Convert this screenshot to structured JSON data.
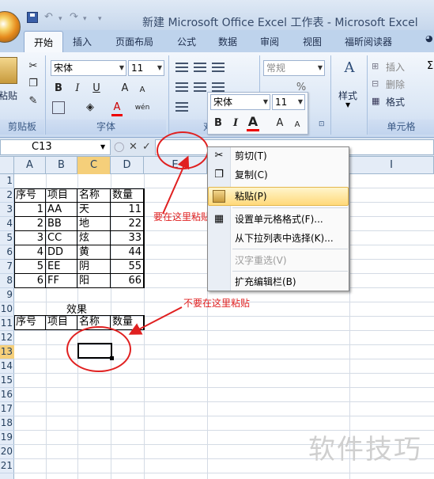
{
  "window": {
    "title": "新建 Microsoft Office Excel 工作表 - Microsoft Excel",
    "quick_access": {
      "undo": "↶",
      "redo": "↷"
    }
  },
  "tabs": [
    "开始",
    "插入",
    "页面布局",
    "公式",
    "数据",
    "审阅",
    "视图",
    "福昕阅读器"
  ],
  "ribbon": {
    "clipboard": {
      "paste": "粘贴",
      "label": "剪贴板"
    },
    "font": {
      "name": "宋体",
      "size": "11",
      "bold": "B",
      "italic": "I",
      "underline": "U",
      "grow": "A",
      "shrink": "A",
      "color_letter": "A",
      "phonetic": "wén",
      "label": "字体"
    },
    "alignment": {
      "label": "对齐"
    },
    "number": {
      "format": "常规",
      "percent": "%"
    },
    "styles": {
      "label": "样式"
    },
    "cells": {
      "insert": "插入",
      "delete": "删除",
      "format": "格式",
      "label": "单元格"
    }
  },
  "formula_bar": {
    "name_box": "C13",
    "fx": "fx",
    "cancel": "✕",
    "enter": "✓"
  },
  "columns": [
    "A",
    "B",
    "C",
    "D",
    "E",
    "I"
  ],
  "rows": [
    "1",
    "2",
    "3",
    "4",
    "5",
    "6",
    "7",
    "8",
    "9",
    "10",
    "11",
    "12",
    "13",
    "14",
    "15",
    "16",
    "17",
    "18",
    "19",
    "20",
    "21"
  ],
  "table1": {
    "headers": [
      "序号",
      "项目",
      "名称",
      "数量"
    ],
    "rows": [
      [
        "1",
        "AA",
        "天",
        "11"
      ],
      [
        "2",
        "BB",
        "地",
        "22"
      ],
      [
        "3",
        "CC",
        "炫",
        "33"
      ],
      [
        "4",
        "DD",
        "黄",
        "44"
      ],
      [
        "5",
        "EE",
        "阴",
        "55"
      ],
      [
        "6",
        "FF",
        "阳",
        "66"
      ]
    ]
  },
  "table2": {
    "title": "效果",
    "headers": [
      "序号",
      "项目",
      "名称",
      "数量"
    ]
  },
  "annotations": {
    "paste_here": "要在这里粘贴",
    "dont_paste_here": "不要在这里粘贴"
  },
  "context_menu": {
    "items": [
      {
        "label": "剪切(T)",
        "icon": "scissors-icon",
        "enabled": true
      },
      {
        "label": "复制(C)",
        "icon": "copy-icon",
        "enabled": true
      },
      {
        "label": "粘贴(P)",
        "icon": "paste-icon",
        "enabled": true,
        "highlighted": true
      },
      {
        "label": "设置单元格格式(F)...",
        "icon": "format-cells-icon",
        "enabled": true
      },
      {
        "label": "从下拉列表中选择(K)...",
        "icon": "",
        "enabled": true
      },
      {
        "label": "汉字重选(V)",
        "icon": "",
        "enabled": false
      },
      {
        "label": "扩充编辑栏(B)",
        "icon": "",
        "enabled": true
      }
    ]
  },
  "mini_toolbar": {
    "font": "宋体",
    "size": "11",
    "bold": "B",
    "italic": "I",
    "color": "A",
    "grow": "A",
    "shrink": "A"
  },
  "watermark": "软件技巧",
  "colors": {
    "annotation": "#e02020",
    "ribbon_bg": "#dae6f5",
    "highlight": "#ffd97a"
  }
}
